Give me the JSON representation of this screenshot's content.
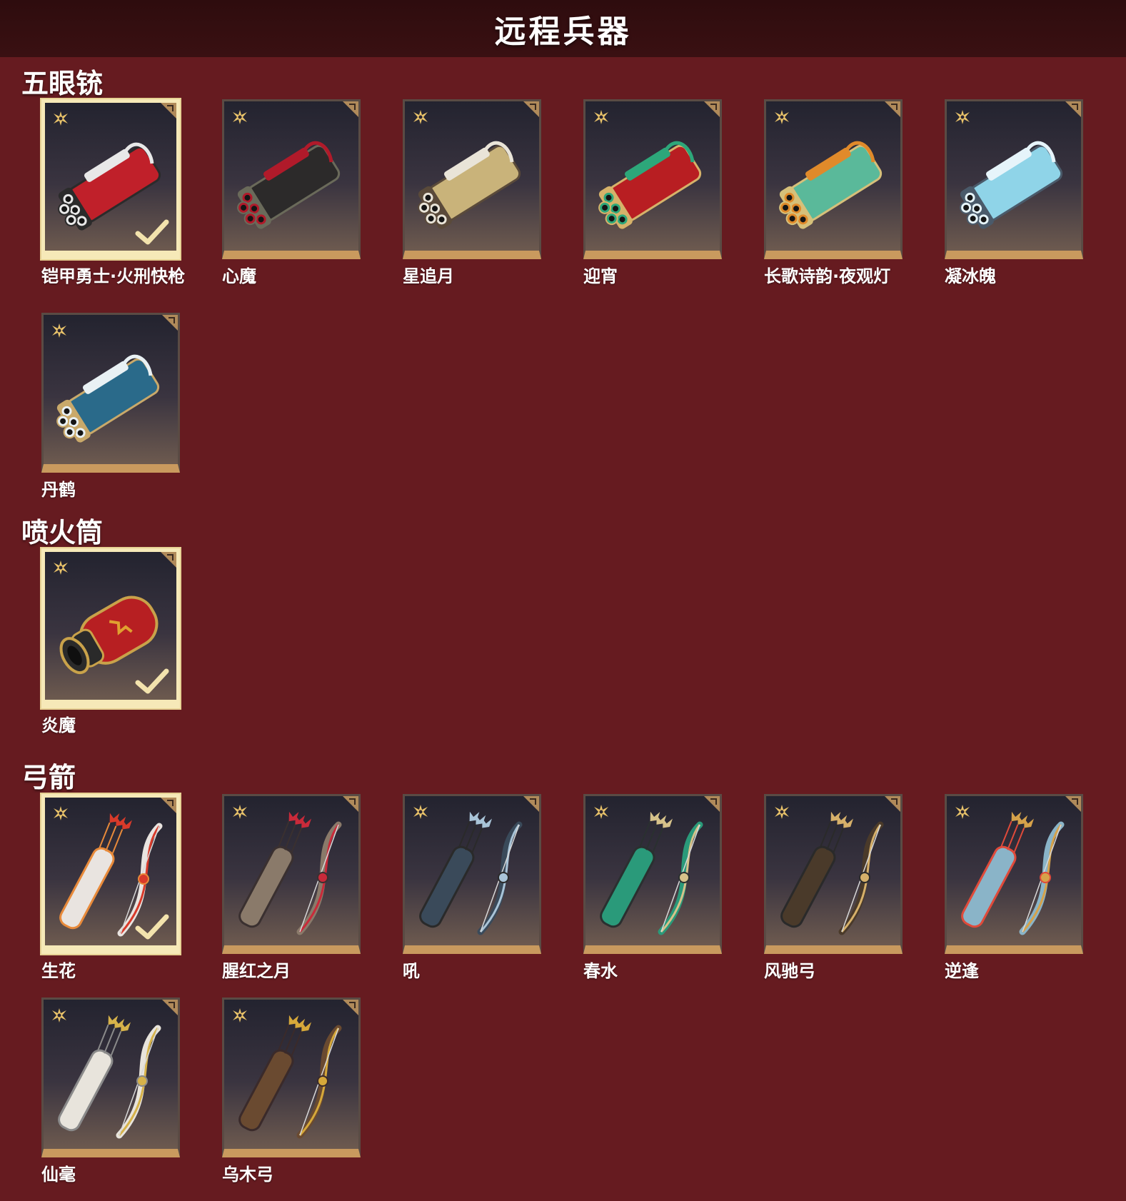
{
  "header": {
    "title": "远程兵器"
  },
  "sections": {
    "s0": {
      "title": "五眼铳"
    },
    "s1": {
      "title": "喷火筒"
    },
    "s2": {
      "title": "弓箭"
    }
  },
  "items": {
    "i0": {
      "label": "铠甲勇士·火刑快枪",
      "selected": true,
      "icon": "multi-barrel-gun",
      "colors": [
        "#c0202a",
        "#e8e8e8",
        "#2b2b2b"
      ]
    },
    "i1": {
      "label": "心魔",
      "selected": false,
      "icon": "multi-barrel-gun",
      "colors": [
        "#2c2a2a",
        "#b01a2a",
        "#6a6a5a"
      ]
    },
    "i2": {
      "label": "星追月",
      "selected": false,
      "icon": "multi-barrel-gun",
      "colors": [
        "#c9b37a",
        "#e9e4d8",
        "#5a4a3a"
      ]
    },
    "i3": {
      "label": "迎宵",
      "selected": false,
      "icon": "multi-barrel-gun",
      "colors": [
        "#b81e22",
        "#2da77a",
        "#d6b26a"
      ]
    },
    "i4": {
      "label": "长歌诗韵·夜观灯",
      "selected": false,
      "icon": "multi-barrel-gun",
      "colors": [
        "#5ab99a",
        "#e08a2a",
        "#d6c07a"
      ]
    },
    "i5": {
      "label": "凝冰魄",
      "selected": false,
      "icon": "multi-barrel-gun",
      "colors": [
        "#8fd4e8",
        "#e6f4fa",
        "#4a5a6a"
      ]
    },
    "i6": {
      "label": "丹鹤",
      "selected": false,
      "icon": "multi-barrel-gun",
      "colors": [
        "#2a6a8a",
        "#e9f1f4",
        "#c9a96a"
      ]
    },
    "i7": {
      "label": "炎魔",
      "selected": true,
      "icon": "flamethrower",
      "colors": [
        "#b71f22",
        "#2a2a2a",
        "#c9a24a"
      ]
    },
    "i8": {
      "label": "生花",
      "selected": true,
      "icon": "bow",
      "colors": [
        "#e9e4e0",
        "#d83a2a",
        "#e88a3a"
      ]
    },
    "i9": {
      "label": "腥红之月",
      "selected": false,
      "icon": "bow",
      "colors": [
        "#8a7a6a",
        "#c92a3a",
        "#3a3030"
      ]
    },
    "i10": {
      "label": "吼",
      "selected": false,
      "icon": "bow",
      "colors": [
        "#3a4a5a",
        "#a9c4d8",
        "#2a2a2a"
      ]
    },
    "i11": {
      "label": "春水",
      "selected": false,
      "icon": "bow",
      "colors": [
        "#2a9a7a",
        "#d6c28a",
        "#2a3030"
      ]
    },
    "i12": {
      "label": "风驰弓",
      "selected": false,
      "icon": "bow",
      "colors": [
        "#4a3a2a",
        "#d6b06a",
        "#2a2a2a"
      ]
    },
    "i13": {
      "label": "逆逢",
      "selected": false,
      "icon": "bow",
      "colors": [
        "#8ab4c8",
        "#d6a24a",
        "#e04a3a"
      ]
    },
    "i14": {
      "label": "仙毫",
      "selected": false,
      "icon": "bow",
      "colors": [
        "#e8e4dc",
        "#d6b24a",
        "#8a8a8a"
      ]
    },
    "i15": {
      "label": "乌木弓",
      "selected": false,
      "icon": "bow",
      "colors": [
        "#6a4a30",
        "#d6a83a",
        "#3a2a2a"
      ]
    }
  }
}
